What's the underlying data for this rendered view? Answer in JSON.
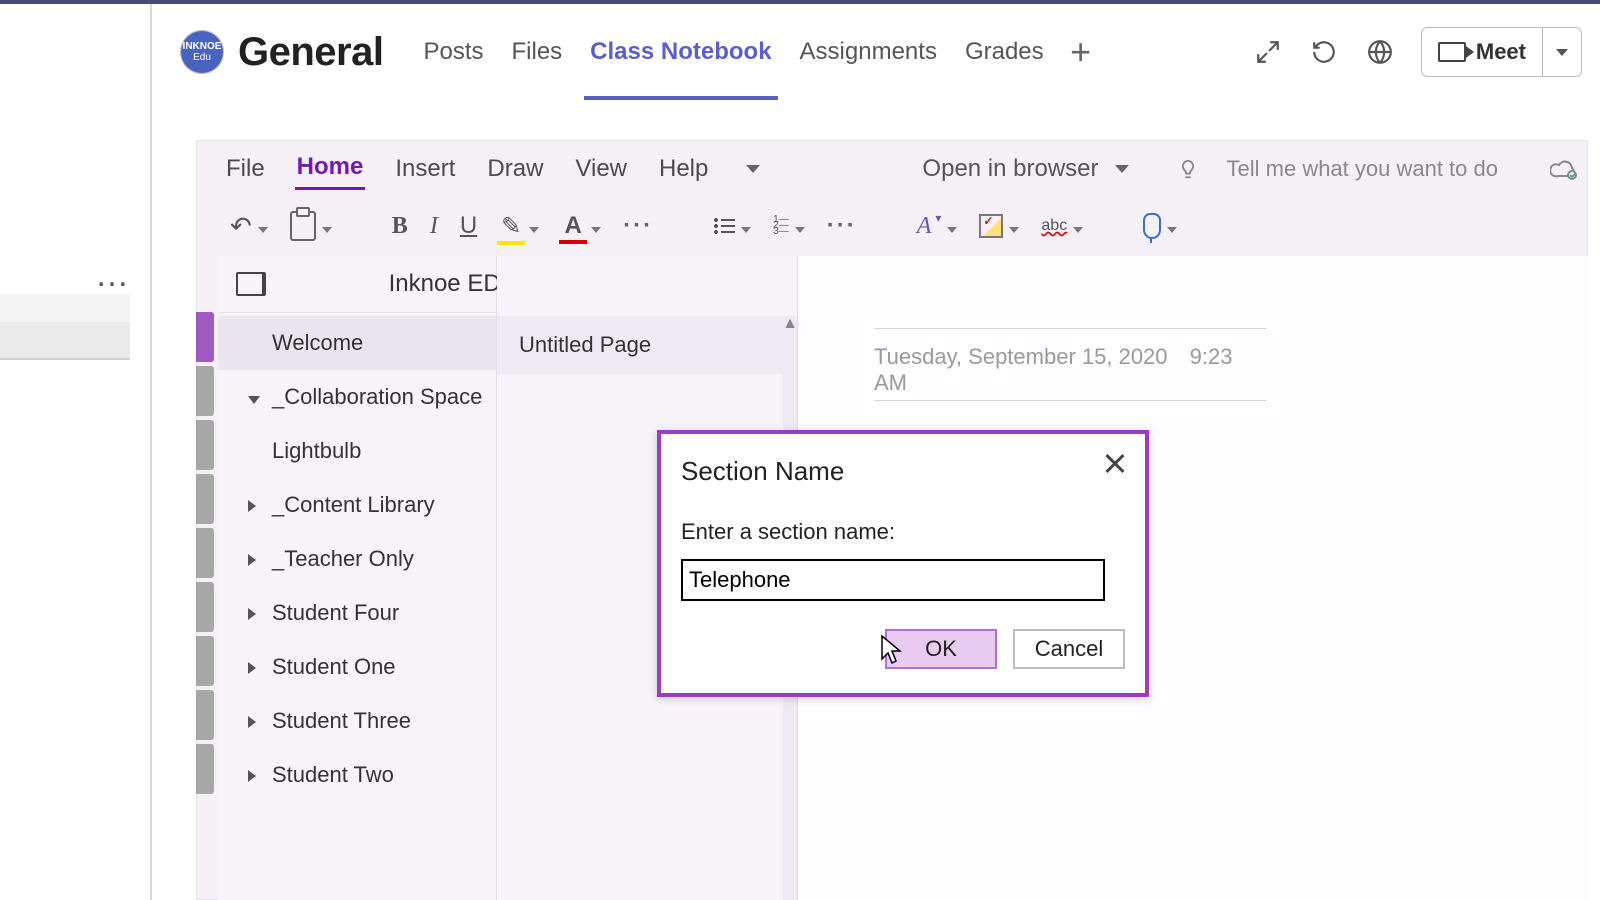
{
  "team": {
    "avatar_line1": "INKNOE",
    "avatar_line2": "Edu",
    "channel": "General"
  },
  "tabs": {
    "posts": "Posts",
    "files": "Files",
    "classnotebook": "Class Notebook",
    "assignments": "Assignments",
    "grades": "Grades"
  },
  "topbar": {
    "meet": "Meet"
  },
  "onenote": {
    "menu": {
      "file": "File",
      "home": "Home",
      "insert": "Insert",
      "draw": "Draw",
      "view": "View",
      "help": "Help",
      "open_in_browser": "Open in browser",
      "tell_me": "Tell me what you want to do"
    },
    "ribbon": {
      "bold": "B",
      "italic": "I",
      "underline": "U",
      "highlight": "✎",
      "fontcolor": "A",
      "styles": "A",
      "spell": "abc"
    },
    "notebook_title": "Inknoe EDU Notebook",
    "sections": {
      "welcome": "Welcome",
      "collab": "_Collaboration Space",
      "lightbulb": "Lightbulb",
      "content": "_Content Library",
      "teacher": "_Teacher Only",
      "s4": "Student Four",
      "s1": "Student One",
      "s3": "Student Three",
      "s2": "Student Two"
    },
    "page": {
      "untitled": "Untitled Page",
      "date": "Tuesday, September 15, 2020",
      "time": "9:23 AM"
    }
  },
  "dialog": {
    "title": "Section Name",
    "label": "Enter a section name:",
    "value": "Telephone",
    "ok": "OK",
    "cancel": "Cancel"
  }
}
